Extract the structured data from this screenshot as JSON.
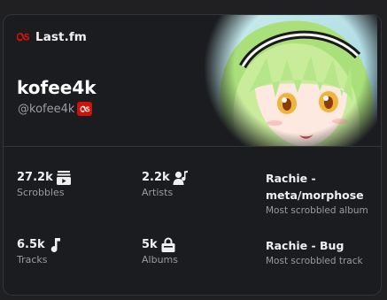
{
  "brand": {
    "name": "Last.fm",
    "accent": "#d51007"
  },
  "profile": {
    "username": "kofee4k",
    "handle": "@kofee4k"
  },
  "stats": {
    "scrobbles": {
      "value": "27.2k",
      "label": "Scrobbles",
      "icon": "playlist-play-icon"
    },
    "artists": {
      "value": "2.2k",
      "label": "Artists",
      "icon": "artist-music-icon"
    },
    "tracks": {
      "value": "6.5k",
      "label": "Tracks",
      "icon": "music-note-icon"
    },
    "albums": {
      "value": "5k",
      "label": "Albums",
      "icon": "album-bag-icon"
    }
  },
  "top_album": {
    "line1": "Rachie -",
    "line2": "meta/morphose",
    "label": "Most scrobbled album"
  },
  "top_track": {
    "value": "Rachie - Bug",
    "label": "Most scrobbled track"
  },
  "colors": {
    "background": "#1b1c1f",
    "border": "#34353a",
    "muted_text": "#9a9ba1"
  }
}
